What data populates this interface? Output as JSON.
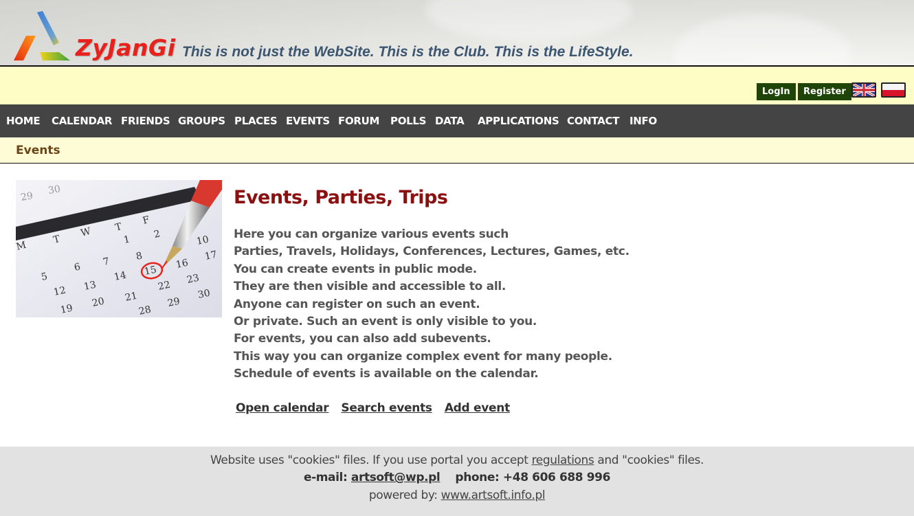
{
  "header": {
    "brand": "ZyJanGi",
    "slogan": "This is not just the WebSite. This is the Club. This is the LifeStyle."
  },
  "topbar": {
    "login_label": "LogIn",
    "register_label": "Register",
    "flags": [
      {
        "name": "english-flag-icon",
        "lang": "English"
      },
      {
        "name": "polish-flag-icon",
        "lang": "Polish"
      }
    ]
  },
  "nav": {
    "items": [
      {
        "label": "HOME"
      },
      {
        "label": "CALENDAR"
      },
      {
        "label": "FRIENDS"
      },
      {
        "label": "GROUPS"
      },
      {
        "label": "PLACES"
      },
      {
        "label": "EVENTS"
      },
      {
        "label": "FORUM"
      },
      {
        "label": "POLLS"
      },
      {
        "label": "DATA"
      },
      {
        "label": "APPLICATIONS"
      },
      {
        "label": "CONTACT"
      },
      {
        "label": "INFO"
      }
    ]
  },
  "breadcrumb": {
    "current": "Events"
  },
  "main": {
    "image_alt": "Calendar with date 15 circled in red",
    "title": "Events, Parties, Trips",
    "description": [
      "Here you can organize various events such",
      "Parties, Travels, Holidays, Conferences, Lectures, Games, etc.",
      "You can create events in public mode.",
      "They are then visible and accessible to all.",
      "Anyone can register on such an event.",
      "Or private. Such an event is only visible to you.",
      "For events, you can also add subevents.",
      "This way you can organize complex event for many people.",
      "Schedule of events is available on the calendar."
    ],
    "actions": [
      {
        "label": "Open calendar"
      },
      {
        "label": "Search events"
      },
      {
        "label": "Add event"
      }
    ]
  },
  "footer": {
    "cookies_prefix": "Website uses \"cookies\" files. If you use portal you accept ",
    "regulations_link": "regulations",
    "cookies_suffix": " and \"cookies\" files.",
    "email_label": "e-mail:",
    "email": "artsoft@wp.pl",
    "phone": "phone: +48 606 688 996",
    "powered_label": "powered by:",
    "powered_link": "www.artsoft.info.pl"
  },
  "colors": {
    "brand_red": "#e8211c",
    "slogan_blue": "#3c5570",
    "nav_bg": "#444444",
    "button_green": "#1f4407",
    "title_red": "#8b1010",
    "yellow_bar": "#fdfdc5"
  }
}
